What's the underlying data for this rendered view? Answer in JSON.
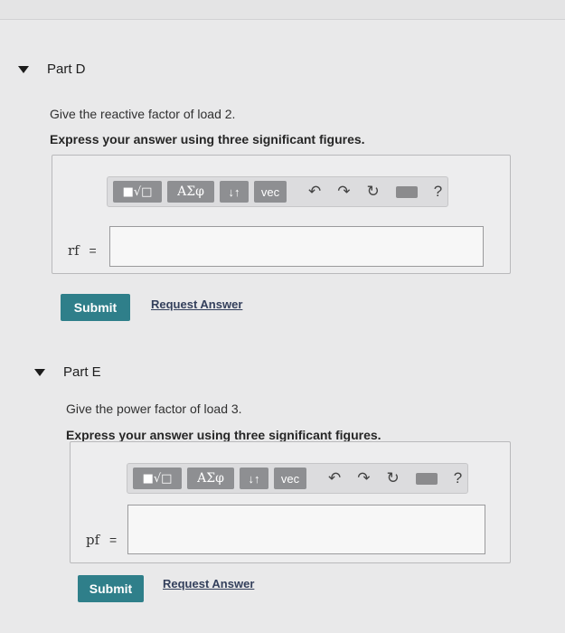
{
  "parts": [
    {
      "title": "Part D",
      "prompt": "Give the reactive factor of load 2.",
      "instruction": "Express your answer using three significant figures.",
      "variable": "rf",
      "equals": "=",
      "input_value": "",
      "toolbar": {
        "sqrt_label": "■√□",
        "greek_label": "ΑΣφ",
        "arrows_label": "↓↑",
        "vec_label": "vec",
        "help_label": "?"
      },
      "submit_label": "Submit",
      "request_label": "Request Answer"
    },
    {
      "title": "Part E",
      "prompt": "Give the power factor of load 3.",
      "instruction": "Express your answer using three significant figures.",
      "variable": "pf",
      "equals": "=",
      "input_value": "",
      "toolbar": {
        "sqrt_label": "■√□",
        "greek_label": "ΑΣφ",
        "arrows_label": "↓↑",
        "vec_label": "vec",
        "help_label": "?"
      },
      "submit_label": "Submit",
      "request_label": "Request Answer"
    }
  ],
  "icons": [
    "undo-icon",
    "redo-icon",
    "reset-icon",
    "keyboard-icon",
    "help-icon"
  ]
}
